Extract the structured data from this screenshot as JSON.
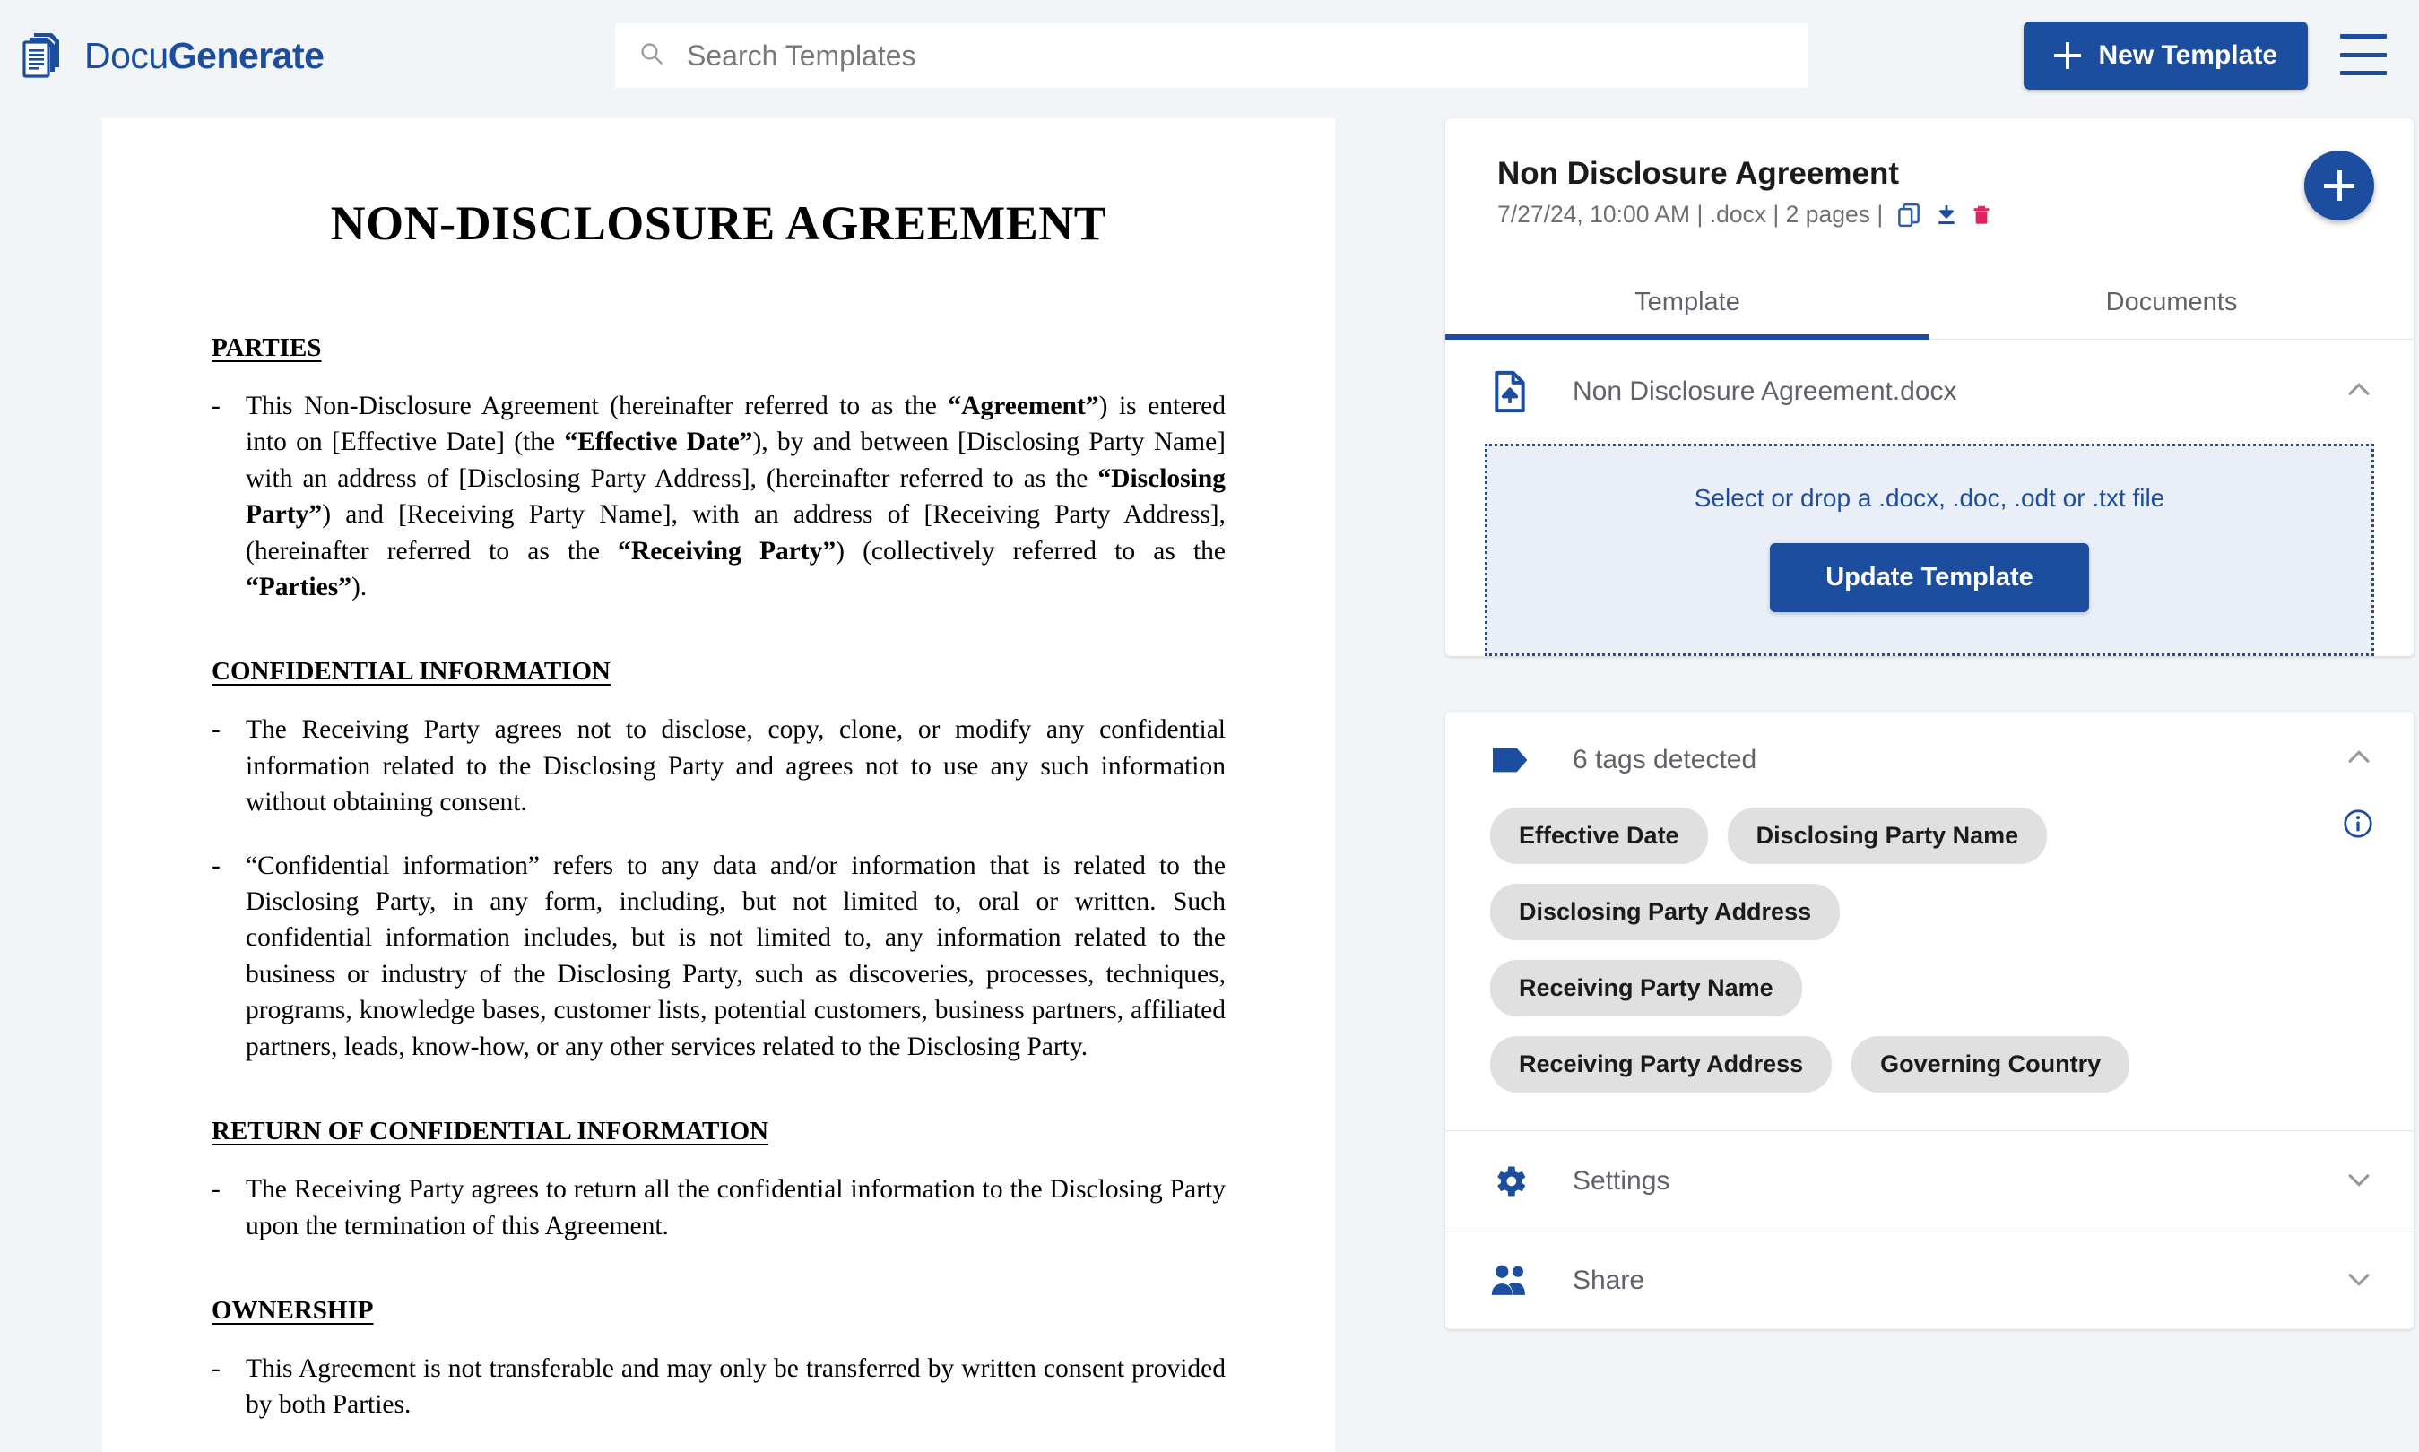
{
  "app": {
    "brand_light": "Docu",
    "brand_bold": "Generate",
    "logo_icon": "documents-stack-icon",
    "accent_color": "#1d4d9e",
    "danger_color": "#e0245e",
    "page_background": "#f1f5f8"
  },
  "header": {
    "search": {
      "icon": "search-icon",
      "placeholder": "Search Templates",
      "value": ""
    },
    "new_template_button": {
      "label": "New Template",
      "icon": "plus-icon"
    },
    "menu_icon": "hamburger-menu-icon"
  },
  "document": {
    "title": "NON-DISCLOSURE AGREEMENT",
    "sections": [
      {
        "heading": "PARTIES",
        "items": [
          "This Non-Disclosure Agreement (hereinafter referred to as the <b>“Agreement”</b>) is entered into on [Effective Date] (the <b>“Effective Date”</b>), by and between [Disclosing Party Name] with an address of [Disclosing Party Address], (hereinafter referred to as the <b>“Disclosing Party”</b>) and [Receiving Party Name], with an address of [Receiving Party Address], (hereinafter referred to as the <b>“Receiving Party”</b>) (collectively referred to as the <b>“Parties”</b>)."
        ]
      },
      {
        "heading": "CONFIDENTIAL INFORMATION",
        "items": [
          "The Receiving Party agrees not to disclose, copy, clone, or modify any confidential information related to the Disclosing Party and agrees not to use any such information without obtaining consent.",
          "“Confidential information” refers to any data and/or information that is related to the Disclosing Party, in any form, including, but not limited to, oral or written. Such confidential information includes, but is not limited to, any information related to the business or industry of the Disclosing Party, such as discoveries, processes, techniques, programs, knowledge bases, customer lists, potential customers, business partners, affiliated partners, leads, know-how, or any other services related to the Disclosing Party."
        ]
      },
      {
        "heading": "RETURN OF CONFIDENTIAL INFORMATION",
        "items": [
          "The Receiving Party agrees to return all the confidential information to the Disclosing Party upon the termination of this Agreement."
        ]
      },
      {
        "heading": "OWNERSHIP",
        "items": [
          "This Agreement is not transferable and may only be transferred by written consent provided by both Parties."
        ]
      }
    ]
  },
  "panel": {
    "title": "Non Disclosure Agreement",
    "meta": {
      "text": "7/27/24, 10:00 AM | .docx | 2 pages |",
      "copy_icon": "copy-icon",
      "download_icon": "download-icon",
      "delete_icon": "trash-icon"
    },
    "add_button": {
      "icon": "plus-icon"
    },
    "tabs": [
      {
        "label": "Template",
        "active": true
      },
      {
        "label": "Documents",
        "active": false
      }
    ],
    "template_section": {
      "icon": "file-upload-icon",
      "filename": "Non Disclosure Agreement.docx",
      "collapse_icon": "chevron-up-icon",
      "dropzone_text": "Select or drop a .docx, .doc, .odt or .txt file",
      "update_button_label": "Update Template"
    },
    "tags_section": {
      "icon": "tag-icon",
      "label": "6 tags detected",
      "collapse_icon": "chevron-up-icon",
      "info_icon": "info-icon",
      "tags": [
        "Effective Date",
        "Disclosing Party Name",
        "Disclosing Party Address",
        "Receiving Party Name",
        "Receiving Party Address",
        "Governing Country"
      ]
    },
    "settings_section": {
      "icon": "gear-icon",
      "label": "Settings",
      "expand_icon": "chevron-down-icon"
    },
    "share_section": {
      "icon": "people-icon",
      "label": "Share",
      "expand_icon": "chevron-down-icon"
    }
  }
}
